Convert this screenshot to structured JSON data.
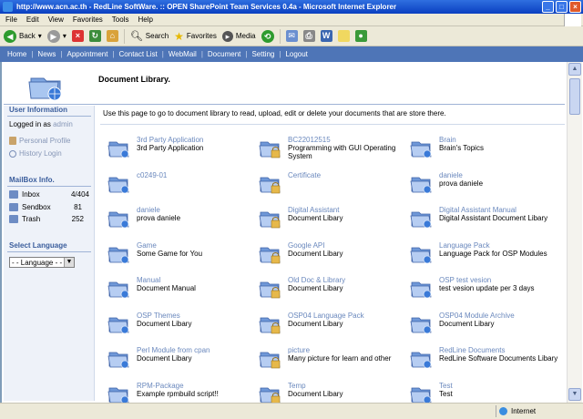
{
  "window": {
    "title": "http://www.acn.ac.th - RedLine SoftWare. :: OPEN SharePoint Team Services 0.4a - Microsoft Internet Explorer"
  },
  "menu": [
    "File",
    "Edit",
    "View",
    "Favorites",
    "Tools",
    "Help"
  ],
  "toolbar": {
    "back": "Back",
    "search": "Search",
    "favorites": "Favorites",
    "media": "Media"
  },
  "nav": [
    "Home",
    "News",
    "Appointment",
    "Contact List",
    "WebMail",
    "Document",
    "Setting",
    "Logout"
  ],
  "page": {
    "title": "Document Library.",
    "description": "Use this page to go to document library to read, upload, edit or delete your documents that are store there."
  },
  "sidebar": {
    "user_info_head": "User Information",
    "logged_label": "Logged in as",
    "username": "admin",
    "personal_profile": "Personal Profile",
    "history_login": "History Login",
    "mailbox_head": "MailBox Info.",
    "mailbox": [
      {
        "label": "Inbox",
        "count": "4/404"
      },
      {
        "label": "Sendbox",
        "count": "81"
      },
      {
        "label": "Trash",
        "count": "252"
      }
    ],
    "language_head": "Select Language",
    "language_value": "- - Language - -"
  },
  "documents": [
    {
      "name": "3rd Party Application",
      "desc": "3rd Party Application",
      "locked": false
    },
    {
      "name": "BC22012515",
      "desc": "Programming with GUI Operating System",
      "locked": true
    },
    {
      "name": "Brain",
      "desc": "Brain's Topics",
      "locked": false
    },
    {
      "name": "c0249-01",
      "desc": "",
      "locked": false
    },
    {
      "name": "Certificate",
      "desc": "",
      "locked": true
    },
    {
      "name": "daniele",
      "desc": "prova daniele",
      "locked": false
    },
    {
      "name": "daniele",
      "desc": "prova daniele",
      "locked": false
    },
    {
      "name": "Digital Assistant",
      "desc": "Document Libary",
      "locked": true
    },
    {
      "name": "Digital Assistant Manual",
      "desc": "Digital Assistant Document Libary",
      "locked": false
    },
    {
      "name": "Game",
      "desc": "Some Game for You",
      "locked": false
    },
    {
      "name": "Google API",
      "desc": "Document Libary",
      "locked": true
    },
    {
      "name": "Language Pack",
      "desc": "Language Pack for OSP Modules",
      "locked": false
    },
    {
      "name": "Manual",
      "desc": "Document Manual",
      "locked": false
    },
    {
      "name": "Old Doc & Library",
      "desc": "Document Libary",
      "locked": true
    },
    {
      "name": "OSP test vesion",
      "desc": "test vesion update per 3 days",
      "locked": false
    },
    {
      "name": "OSP Themes",
      "desc": "Document Libary",
      "locked": false
    },
    {
      "name": "OSP04 Language Pack",
      "desc": "Document Libary",
      "locked": true
    },
    {
      "name": "OSP04 Module Archive",
      "desc": "Document Libary",
      "locked": false
    },
    {
      "name": "Perl Module from cpan",
      "desc": "Document Libary",
      "locked": false
    },
    {
      "name": "picture",
      "desc": "Many picture for learn and other",
      "locked": true
    },
    {
      "name": "RedLine Documents",
      "desc": "RedLine Software Documents Libary",
      "locked": false
    },
    {
      "name": "RPM-Package",
      "desc": "Example rpmbuild script!!",
      "locked": false
    },
    {
      "name": "Temp",
      "desc": "Document Libary",
      "locked": true
    },
    {
      "name": "Test",
      "desc": "Test",
      "locked": false
    }
  ],
  "status": {
    "zone": "Internet"
  }
}
